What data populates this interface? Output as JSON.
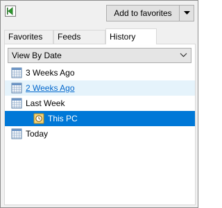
{
  "toolbar": {
    "add_favorites_label": "Add to favorites"
  },
  "tabs": [
    {
      "label": "Favorites"
    },
    {
      "label": "Feeds"
    },
    {
      "label": "History"
    }
  ],
  "view_select": {
    "selected": "View By Date"
  },
  "history": [
    {
      "label": "3 Weeks Ago",
      "icon": "calendar-icon"
    },
    {
      "label": "2 Weeks Ago",
      "icon": "calendar-icon"
    },
    {
      "label": "Last Week",
      "icon": "calendar-icon"
    },
    {
      "label": "This PC",
      "icon": "computer-icon"
    },
    {
      "label": "Today",
      "icon": "calendar-icon"
    }
  ],
  "colors": {
    "selection": "#0078d7",
    "hover": "#e5f3fb",
    "link": "#0066cc",
    "pin_arrow": "#2e9a2e"
  }
}
